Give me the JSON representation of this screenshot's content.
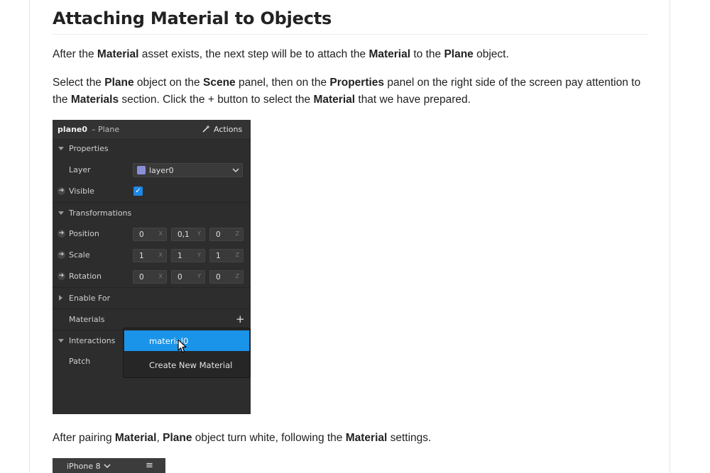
{
  "article": {
    "title": "Attaching Material to Objects",
    "para1": {
      "t1": "After the ",
      "b1": "Material",
      "t2": " asset exists, the next step will be to attach the ",
      "b2": "Material",
      "t3": " to the ",
      "b3": "Plane",
      "t4": " object."
    },
    "para2": {
      "t1": "Select the ",
      "b1": "Plane",
      "t2": " object on the ",
      "b2": "Scene",
      "t3": " panel, then on the ",
      "b3": "Properties",
      "t4": " panel on the right side of the screen pay attention to the ",
      "b4": "Materials",
      "t5": " section. Click the + button to select the ",
      "b5": "Material",
      "t6": " that we have prepared."
    },
    "para3": {
      "t1": "After pairing ",
      "b1": "Material",
      "t2": ", ",
      "b2": "Plane",
      "t3": " object turn white, following the ",
      "b3": "Material",
      "t4": " settings."
    }
  },
  "panel": {
    "object_name": "plane0",
    "object_type": "– Plane",
    "actions_label": "Actions",
    "sections": {
      "properties": "Properties",
      "layer": "Layer",
      "layer_value": "layer0",
      "visible": "Visible",
      "transformations": "Transformations",
      "position": "Position",
      "scale": "Scale",
      "rotation": "Rotation",
      "enable_for": "Enable For",
      "materials": "Materials",
      "interactions": "Interactions",
      "patch": "Patch"
    },
    "axis": {
      "x": "X",
      "y": "Y",
      "z": "Z"
    },
    "position_values": [
      "0",
      "0,1",
      "0"
    ],
    "scale_values": [
      "1",
      "1",
      "1"
    ],
    "rotation_values": [
      "0",
      "0",
      "0"
    ],
    "plus_glyph": "+",
    "check_glyph": "✓",
    "dropdown": {
      "selected": "material0",
      "create": "Create New Material"
    }
  },
  "device_bar": {
    "label": "iPhone 8",
    "chevron": "⌄",
    "menu_glyph": "≡"
  },
  "colors": {
    "panel_bg": "#2d2d2d",
    "accent_blue": "#1a94e9",
    "layer_swatch": "#8a90d8"
  }
}
